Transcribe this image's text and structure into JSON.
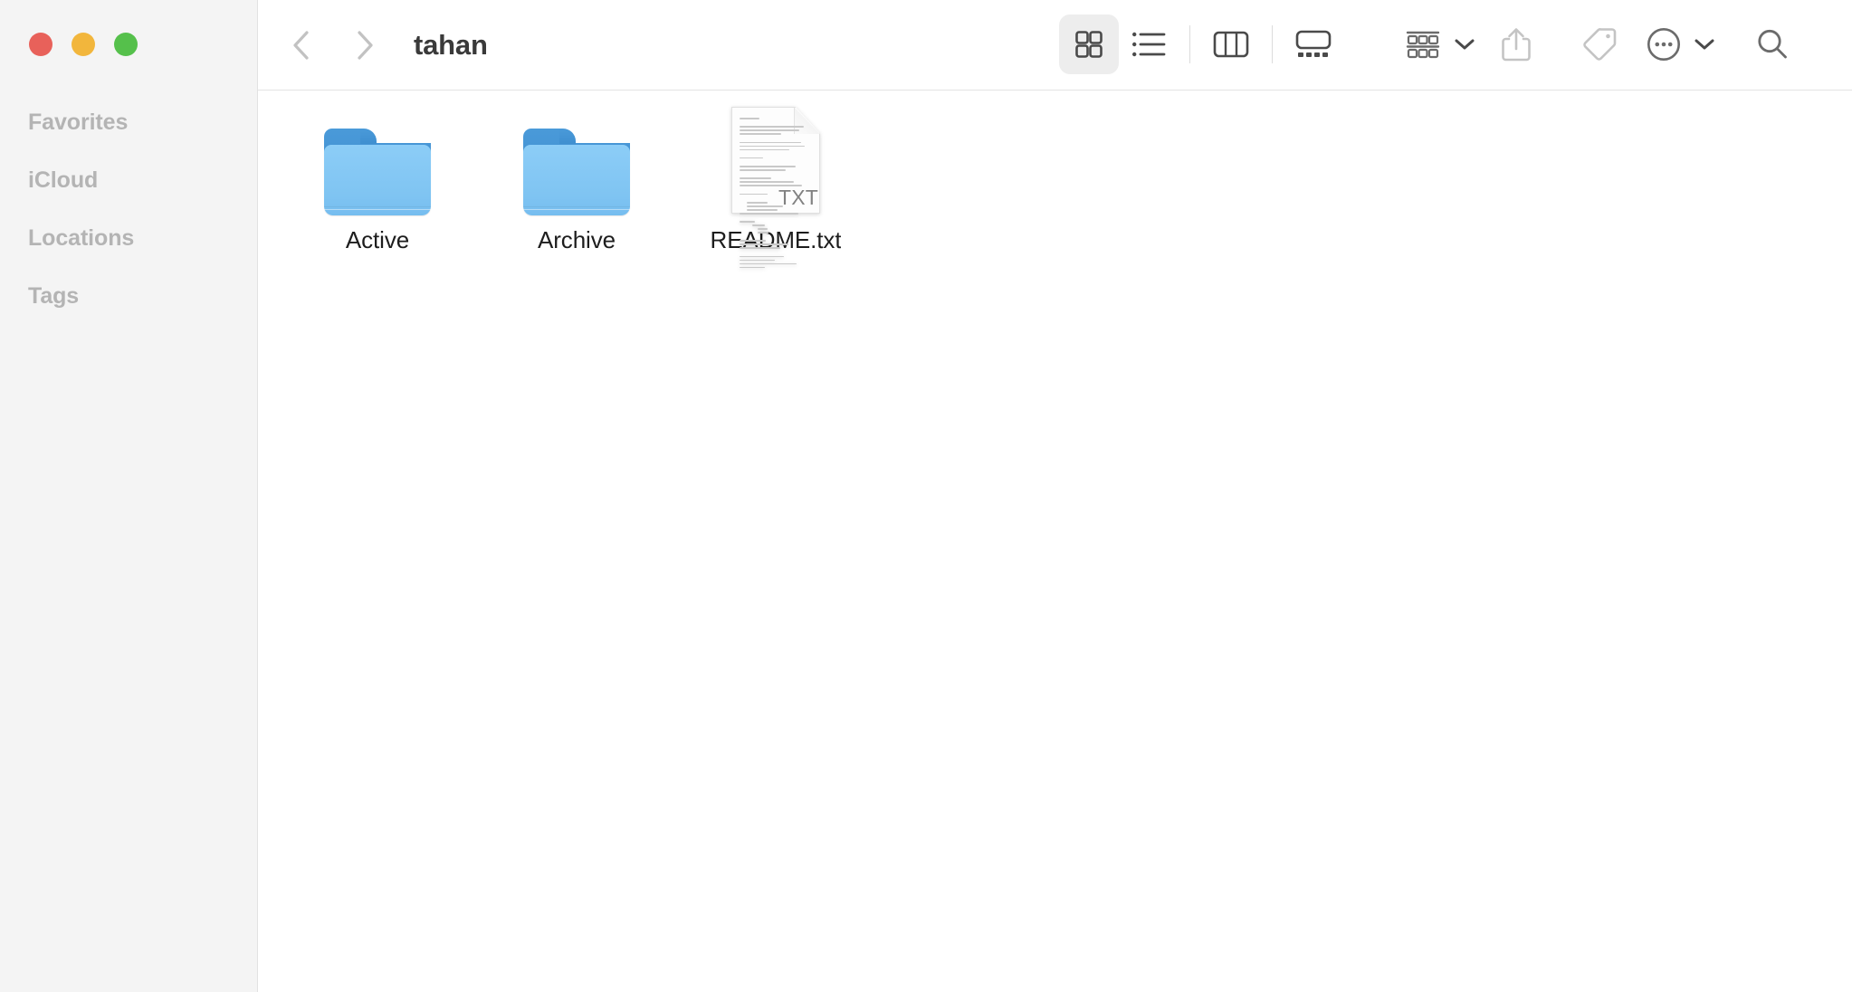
{
  "window": {
    "title": "tahan",
    "traffic_lights": [
      {
        "name": "close",
        "color": "#e8615a"
      },
      {
        "name": "minimize",
        "color": "#f2b63c"
      },
      {
        "name": "zoom",
        "color": "#55c04b"
      }
    ]
  },
  "sidebar": {
    "sections": [
      {
        "label": "Favorites"
      },
      {
        "label": "iCloud"
      },
      {
        "label": "Locations"
      },
      {
        "label": "Tags"
      }
    ]
  },
  "toolbar": {
    "back_icon": "chevron-left-icon",
    "forward_icon": "chevron-right-icon",
    "view_modes": [
      {
        "name": "icon-view",
        "icon": "grid-icon",
        "selected": true
      },
      {
        "name": "list-view",
        "icon": "list-icon",
        "selected": false
      },
      {
        "name": "column-view",
        "icon": "columns-icon",
        "selected": false
      },
      {
        "name": "gallery-view",
        "icon": "gallery-icon",
        "selected": false
      }
    ],
    "actions": [
      {
        "name": "group-by",
        "icon": "group-icon",
        "has_chevron": true
      },
      {
        "name": "share",
        "icon": "share-icon",
        "has_chevron": false
      },
      {
        "name": "tags",
        "icon": "tag-icon",
        "has_chevron": false
      },
      {
        "name": "more",
        "icon": "ellipsis-circle-icon",
        "has_chevron": true
      },
      {
        "name": "search",
        "icon": "search-icon",
        "has_chevron": false
      }
    ]
  },
  "files": [
    {
      "name": "Active",
      "type": "folder"
    },
    {
      "name": "Archive",
      "type": "folder"
    },
    {
      "name": "README.txt",
      "type": "document",
      "extension": "TXT"
    }
  ],
  "colors": {
    "sidebar_bg": "#f4f4f4",
    "content_bg": "#ffffff",
    "folder_back": "#3b88cb",
    "folder_front": "#83c8f5",
    "label_text": "#1d1d1d",
    "section_text": "#b4b4b4",
    "toolbar_icon": "#6b6b6b",
    "selected_btn_bg": "#ededed"
  }
}
